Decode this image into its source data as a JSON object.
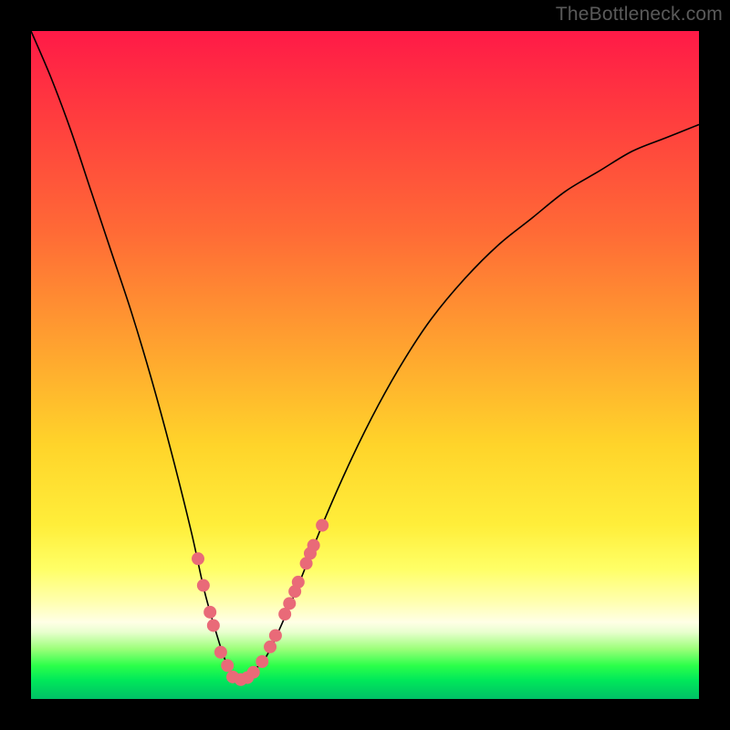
{
  "watermark": "TheBottleneck.com",
  "colors": {
    "frame_border": "#000000",
    "curve_stroke": "#000000",
    "marker_fill": "#e96a78",
    "marker_stroke": "#c94a5a"
  },
  "chart_data": {
    "type": "line",
    "title": "",
    "xlabel": "",
    "ylabel": "",
    "xlim": [
      0,
      100
    ],
    "ylim": [
      0,
      100
    ],
    "x": [
      0,
      3,
      6,
      9,
      12,
      15,
      18,
      21,
      24,
      26,
      28,
      29,
      30,
      31,
      32,
      33,
      35,
      37,
      40,
      44,
      48,
      52,
      56,
      60,
      65,
      70,
      75,
      80,
      85,
      90,
      95,
      100
    ],
    "values": [
      100,
      93,
      85,
      76,
      67,
      58,
      48,
      37,
      25,
      16,
      9,
      6,
      4,
      3,
      3,
      4,
      6,
      10,
      17,
      27,
      36,
      44,
      51,
      57,
      63,
      68,
      72,
      76,
      79,
      82,
      84,
      86
    ],
    "curve_vertex_x": 31,
    "markers": [
      {
        "x": 25.0,
        "y": 21
      },
      {
        "x": 25.8,
        "y": 17
      },
      {
        "x": 26.8,
        "y": 13
      },
      {
        "x": 27.3,
        "y": 11
      },
      {
        "x": 28.4,
        "y": 7
      },
      {
        "x": 29.4,
        "y": 5
      },
      {
        "x": 30.2,
        "y": 3.3
      },
      {
        "x": 31.4,
        "y": 2.9
      },
      {
        "x": 32.4,
        "y": 3.2
      },
      {
        "x": 33.3,
        "y": 4.0
      },
      {
        "x": 34.6,
        "y": 5.6
      },
      {
        "x": 35.8,
        "y": 7.8
      },
      {
        "x": 36.6,
        "y": 9.5
      },
      {
        "x": 38.0,
        "y": 12.7
      },
      {
        "x": 38.7,
        "y": 14.3
      },
      {
        "x": 39.5,
        "y": 16.1
      },
      {
        "x": 40.0,
        "y": 17.5
      },
      {
        "x": 41.2,
        "y": 20.3
      },
      {
        "x": 41.8,
        "y": 21.8
      },
      {
        "x": 42.3,
        "y": 23.0
      },
      {
        "x": 43.6,
        "y": 26.0
      }
    ],
    "marker_radius": 7
  }
}
